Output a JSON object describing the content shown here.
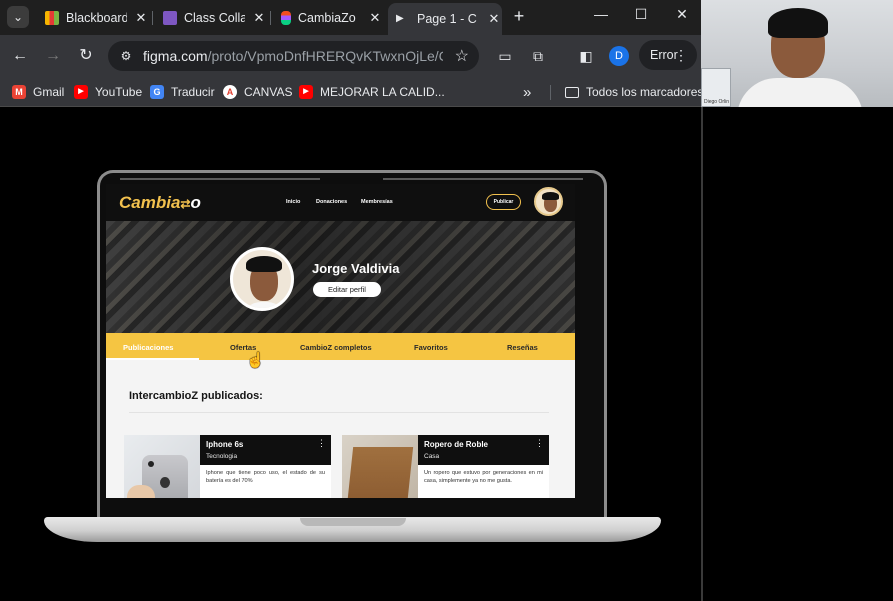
{
  "browser": {
    "tabs": [
      {
        "title": "Blackboard",
        "close": "✕",
        "fav_color": "#f7b500"
      },
      {
        "title": "Class Colla",
        "close": "✕",
        "fav_color": "#7e57c2"
      },
      {
        "title": "CambiaZo",
        "close": "✕",
        "fav_color": "#f24e1e"
      },
      {
        "title": "Page 1 - C",
        "close": "✕",
        "fav_color": "#e8eaed"
      }
    ],
    "new_tab": "+",
    "window": {
      "minimize": "—",
      "maximize": "☐",
      "close": "✕"
    },
    "url_host": "figma.com",
    "url_path": "/proto/VpmoDnfHRERQvKTwxnOjLe/Cam...",
    "profile_initial": "D",
    "error_label": "Error",
    "bookmarks": [
      {
        "label": "Gmail",
        "icon": "gmail-icon",
        "color": "#ea4335",
        "glyph": "M"
      },
      {
        "label": "YouTube",
        "icon": "youtube-icon",
        "color": "#ff0000",
        "glyph": "▶"
      },
      {
        "label": "Traducir",
        "icon": "translate-icon",
        "color": "#4285f4",
        "glyph": "G"
      },
      {
        "label": "CANVAS",
        "icon": "canvas-icon",
        "color": "#e13d2e",
        "glyph": "A"
      },
      {
        "label": "MEJORAR LA CALID...",
        "icon": "youtube-icon",
        "color": "#ff0000",
        "glyph": "▶"
      }
    ],
    "more_bookmarks": "»",
    "all_bookmarks": "Todos los marcadores"
  },
  "webcam": {
    "name": "Diego Orlin"
  },
  "site": {
    "logo": "Cambia",
    "logo_suffix": "o",
    "nav": [
      "Inicio",
      "Donaciones",
      "Membresías"
    ],
    "publish": "Publicar",
    "profile_name": "Jorge Valdivia",
    "edit_profile": "Editar perfil",
    "tabs": [
      "Publicaciones",
      "Ofertas",
      "CambioZ completos",
      "Favoritos",
      "Reseñas"
    ],
    "section_title": "IntercambioZ publicados:",
    "items": [
      {
        "name": "Iphone 6s",
        "category": "Tecnologia",
        "description": "Iphone que tiene poco uso, el estado de su batería es del 70%"
      },
      {
        "name": "Ropero de Roble",
        "category": "Casa",
        "description": "Un ropero que estuvo por generaciones en mi casa, simplemente ya no me gusta."
      }
    ]
  }
}
